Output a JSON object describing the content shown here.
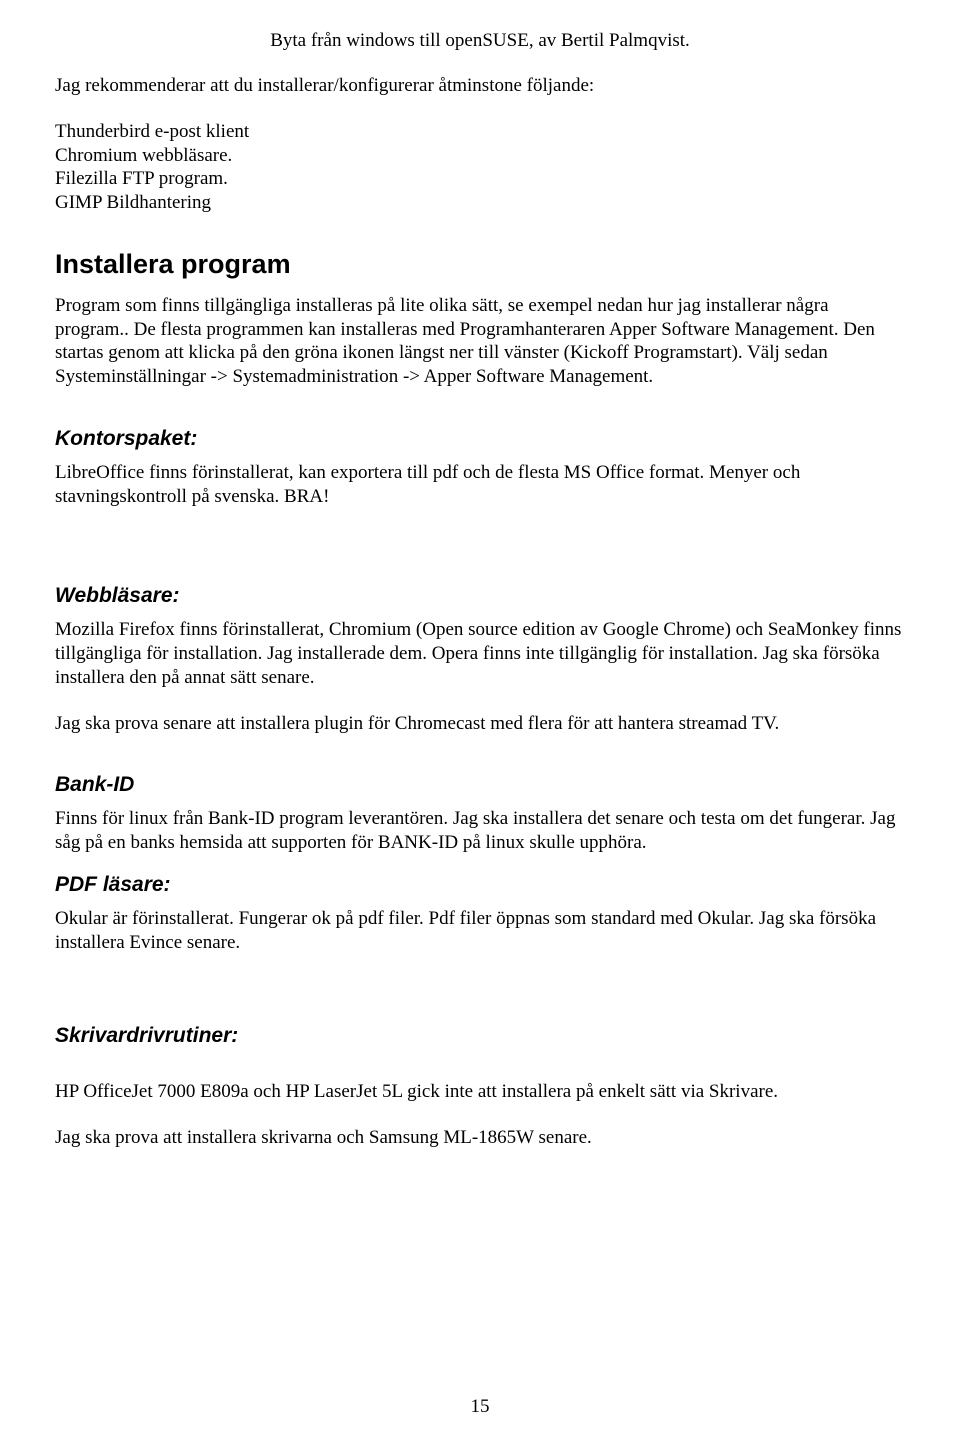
{
  "header": {
    "title": "Byta från windows till openSUSE, av Bertil Palmqvist."
  },
  "intro": {
    "p1": "Jag rekommenderar att du installerar/konfigurerar åtminstone följande:",
    "items": [
      "Thunderbird e-post klient",
      "Chromium webbläsare.",
      "Filezilla FTP program.",
      "GIMP Bildhantering"
    ]
  },
  "section_installera": {
    "heading": "Installera  program",
    "body": "Program som finns tillgängliga installeras på lite olika sätt, se exempel nedan hur jag installerar några program.. De flesta programmen kan installeras med Programhanteraren Apper Software Management. Den startas genom att klicka på den gröna ikonen längst ner till vänster (Kickoff Programstart). Välj sedan Systeminställningar -> Systemadministration -> Apper Software Management."
  },
  "section_kontorspaket": {
    "heading": "Kontorspaket:",
    "body": "LibreOffice finns förinstallerat, kan exportera till pdf och de flesta MS Office format. Menyer och stavningskontroll på svenska. BRA!"
  },
  "section_webblasare": {
    "heading": "Webbläsare:",
    "body1": "Mozilla Firefox finns förinstallerat, Chromium (Open source edition av Google Chrome) och SeaMonkey finns tillgängliga för installation. Jag installerade dem. Opera finns inte tillgänglig för installation. Jag ska försöka installera den på annat sätt senare.",
    "body2": "Jag ska prova senare att installera plugin för Chromecast med flera för att hantera streamad TV."
  },
  "section_bankid": {
    "heading": "Bank-ID",
    "body": "Finns för linux från Bank-ID program leverantören. Jag ska installera det senare och testa om det fungerar.  Jag såg på en banks hemsida att supporten för BANK-ID på linux skulle upphöra."
  },
  "section_pdf": {
    "heading": "PDF läsare:",
    "body": "Okular är förinstallerat. Fungerar ok på pdf filer. Pdf filer öppnas som standard med Okular. Jag ska försöka installera Evince senare."
  },
  "section_skrivardrivrutiner": {
    "heading": "Skrivardrivrutiner:",
    "body1": "HP OfficeJet 7000 E809a och HP LaserJet 5L gick inte att installera på enkelt sätt via Skrivare.",
    "body2": "Jag ska prova att installera skrivarna och Samsung ML-1865W senare."
  },
  "page_number": "15"
}
